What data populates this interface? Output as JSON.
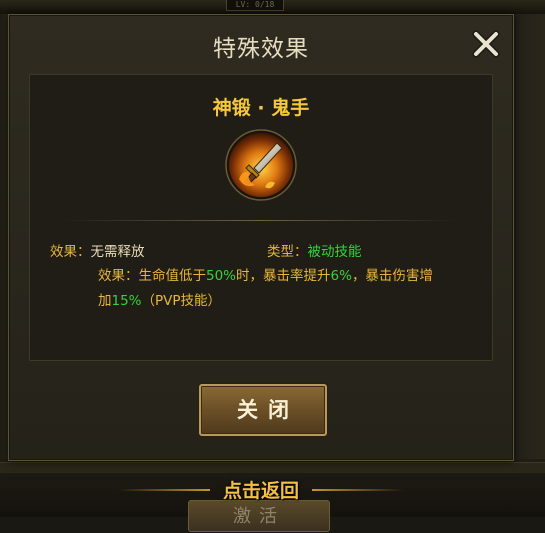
{
  "background": {
    "lv_text": "LV: 0/18",
    "back_label": "点击返回",
    "activate_label": "激活"
  },
  "modal": {
    "title": "特殊效果",
    "skill_name": "神锻 · 鬼手",
    "effect_label": "效果：",
    "effect_value": "无需释放",
    "type_label": "类型：",
    "type_value": "被动技能",
    "desc_label": "效果：",
    "desc_part1": "生命值低于",
    "desc_pct1": "50%",
    "desc_part2": "时，暴击率提升",
    "desc_pct2": "6%",
    "desc_part3": "，暴击伤害增",
    "desc_part4": "加",
    "desc_pct3": "15%",
    "desc_part5": "（PVP技能）",
    "close_button": "关闭"
  },
  "colors": {
    "accent_gold": "#e7b63a",
    "highlight_green": "#36d33a",
    "title_text": "#e6dcc0"
  },
  "icons": {
    "close": "close-x-icon",
    "skill": "sword-skill-icon"
  }
}
